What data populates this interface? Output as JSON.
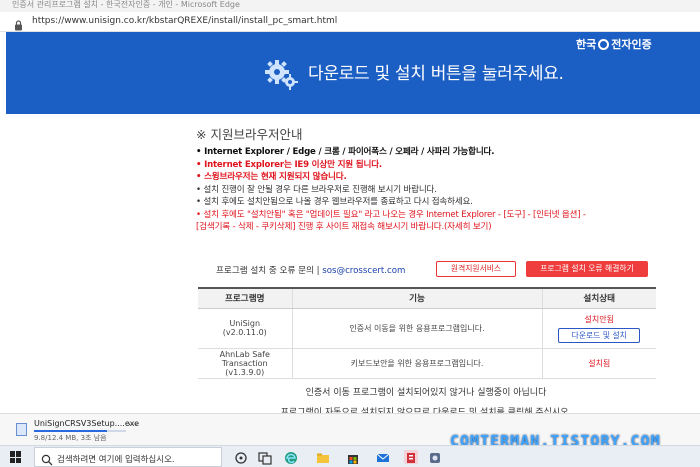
{
  "window": {
    "title": "인증서 관리프로그램 설치 - 한국전자인증 - 개인 - Microsoft Edge",
    "url": "https://www.unisign.co.kr/kbstarQREXE/install/install_pc_smart.html"
  },
  "banner": {
    "headline": "다운로드 및 설치 버튼을 눌러주세요.",
    "logo_left": "한국",
    "logo_right": "전자인증",
    "color": "#1c5fc4"
  },
  "notes": {
    "title": "※ 지원브라우저안내",
    "lines": [
      "• Internet Explorer / Edge / 크롬 / 파이어폭스 / 오페라 / 사파리 가능합니다.",
      "• Internet Explorer는 IE9 이상만 지원 됩니다.",
      "• 스윙브라우저는 현재 지원되지 않습니다.",
      "• 설치 진행이 잘 안될 경우 다른 브라우저로 진행해 보시기 바랍니다.",
      "• 설치 후에도 설치안됨으로 나올 경우 웹브라우저를 종료하고 다시 접속하세요.",
      "• 설치 후에도 \"설치안됨\" 혹은 \"업데이트 필요\" 라고 나오는 경우 Internet Explorer - [도구] - [인터넷 옵션] -",
      "[검색기록 - 삭제 - 쿠키삭제] 진행 후 사이트 재접속 해보시기 바랍니다."
    ],
    "detail_link": "(자세히 보기)"
  },
  "contact": {
    "label": "프로그램 설치 중 오류 문의 |",
    "email": "sos@crosscert.com",
    "remote_button": "원격지원서비스",
    "fix_button": "프로그램 설치 오류 해결하기"
  },
  "table": {
    "headers": [
      "프로그램명",
      "기능",
      "설치상태"
    ],
    "rows": [
      {
        "name": "UniSign",
        "version": "(v2.0.11.0)",
        "function": "인증서 이동을 위한 응용프로그램입니다.",
        "status": "설치안됨",
        "action": "다운로드 및 설치"
      },
      {
        "name": "AhnLab Safe Transaction",
        "version": "(v1.3.9.0)",
        "function": "키보드보안을 위한 응용프로그램입니다.",
        "status": "설치됨"
      }
    ]
  },
  "bottom_note": "인증서 이동 프로그램이 설치되어있지 않거나 실행중이 아닙니다",
  "bottom_note_2": "프로그램이 자동으로 설치되지 않으므로 다운로드 및 설치를 클릭해 주십시오.",
  "download": {
    "filename": "UniSignCRSV3Setup....exe",
    "status": "9.8/12.4 MB, 3초 남음",
    "progress": 0.79,
    "more": "···"
  },
  "watermark": "COMTERMAN.TISTORY.COM",
  "taskbar": {
    "search_placeholder": "검색하려면 여기에 입력하십시오."
  }
}
